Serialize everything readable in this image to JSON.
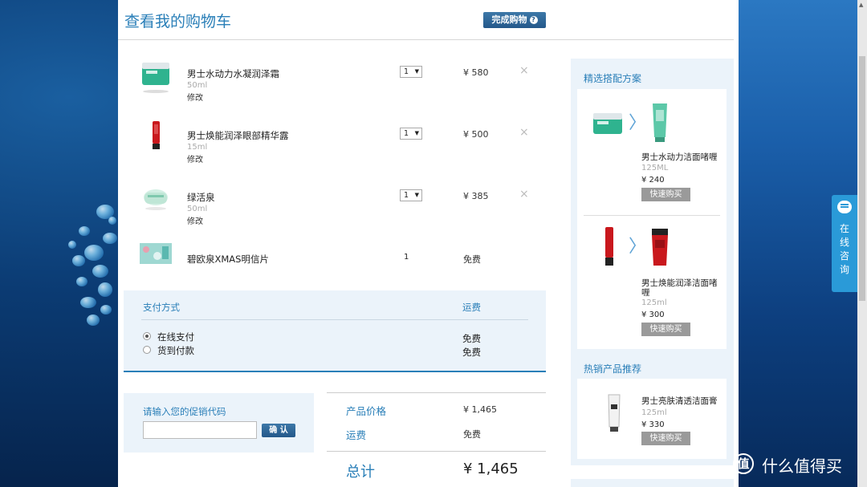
{
  "page": {
    "title": "查看我的购物车",
    "finish_button": "完成购物",
    "finish_help": "?"
  },
  "cart": {
    "items": [
      {
        "name": "男士水动力水凝润泽霜",
        "size": "50ml",
        "edit": "修改",
        "qty": "1",
        "price": "¥ 580",
        "remove": "×"
      },
      {
        "name": "男士焕能润泽眼部精华露",
        "size": "15ml",
        "edit": "修改",
        "qty": "1",
        "price": "¥ 500",
        "remove": "×"
      },
      {
        "name": "绿活泉",
        "size": "50ml",
        "edit": "修改",
        "qty": "1",
        "price": "¥ 385",
        "remove": "×"
      },
      {
        "name": "碧欧泉XMAS明信片",
        "qty": "1",
        "price": "免费"
      }
    ]
  },
  "payment": {
    "heading": "支付方式",
    "shipping_heading": "运费",
    "options": [
      {
        "label": "在线支付",
        "selected": true,
        "shipping": "免费"
      },
      {
        "label": "货到付款",
        "selected": false,
        "shipping": "免费"
      }
    ]
  },
  "promo": {
    "label": "请输入您的促销代码",
    "value": "",
    "confirm": "确 认"
  },
  "summary": {
    "product_price_label": "产品价格",
    "product_price": "¥ 1,465",
    "shipping_label": "运费",
    "shipping": "免费",
    "total_label": "总计",
    "total": "¥ 1,465"
  },
  "recommendations": {
    "bundle_title": "精选搭配方案",
    "bundles": [
      {
        "name": "男士水动力洁面啫喱",
        "size": "125ML",
        "price": "¥ 240",
        "buy": "快速购买"
      },
      {
        "name": "男士焕能润泽洁面啫喱",
        "size": "125ml",
        "price": "¥ 300",
        "buy": "快速购买"
      }
    ],
    "hot_title": "热销产品推荐",
    "hot": [
      {
        "name": "男士亮肤清透洁面膏",
        "size": "125ml",
        "price": "¥ 330",
        "buy": "快速购买"
      }
    ]
  },
  "consult": {
    "label": "在线咨询"
  },
  "watermark": {
    "logo": "值",
    "text": "什么值得买"
  },
  "colors": {
    "accent": "#2a7fb8",
    "button": "#24588a",
    "panel_bg": "#ebf3fa",
    "consult": "#2a9ad8"
  }
}
